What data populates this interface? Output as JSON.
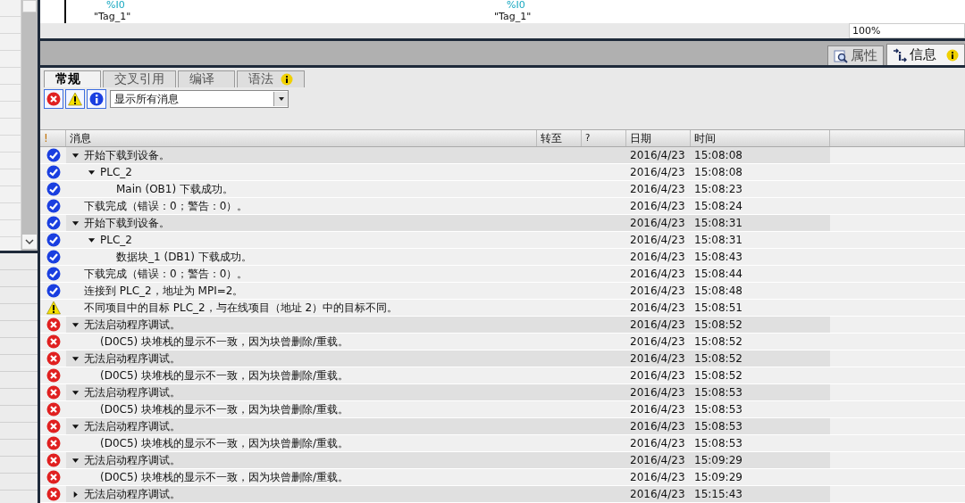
{
  "editor": {
    "operands": [
      {
        "address": "%I0",
        "tag": "\"Tag_1\""
      },
      {
        "address": "%I0",
        "tag": "\"Tag_1\""
      }
    ],
    "zoom": "100%"
  },
  "inspector_tabs": [
    {
      "label": "属性",
      "kind": "properties",
      "selected": false,
      "info": false
    },
    {
      "label": "信息",
      "kind": "info",
      "selected": true,
      "info": true
    }
  ],
  "tabs": [
    {
      "label": "常规",
      "selected": true,
      "info": false
    },
    {
      "label": "交叉引用",
      "selected": false,
      "info": false
    },
    {
      "label": "编译",
      "selected": false,
      "info": false
    },
    {
      "label": "语法",
      "selected": false,
      "info": true
    }
  ],
  "filters": [
    {
      "kind": "error",
      "on": true
    },
    {
      "kind": "warning",
      "on": true
    },
    {
      "kind": "info",
      "on": true
    }
  ],
  "filter_select": {
    "value": "显示所有消息"
  },
  "columns": [
    "!",
    "消息",
    "转至",
    "?",
    "日期",
    "时间"
  ],
  "messages": [
    {
      "kind": "success",
      "text": "开始下载到设备。",
      "date": "2016/4/23",
      "time": "15:08:08",
      "expanded": true,
      "children": [
        {
          "kind": "success",
          "text": "PLC_2",
          "date": "2016/4/23",
          "time": "15:08:08",
          "expanded": true,
          "children": [
            {
              "kind": "success",
              "text": "Main (OB1) 下载成功。",
              "date": "2016/4/23",
              "time": "15:08:23"
            }
          ]
        }
      ]
    },
    {
      "kind": "success",
      "text": "下载完成（错误：0；警告：0）。",
      "date": "2016/4/23",
      "time": "15:08:24"
    },
    {
      "kind": "success",
      "text": "开始下载到设备。",
      "date": "2016/4/23",
      "time": "15:08:31",
      "expanded": true,
      "children": [
        {
          "kind": "success",
          "text": "PLC_2",
          "date": "2016/4/23",
          "time": "15:08:31",
          "expanded": true,
          "children": [
            {
              "kind": "success",
              "text": "数据块_1 (DB1) 下载成功。",
              "date": "2016/4/23",
              "time": "15:08:43"
            }
          ]
        }
      ]
    },
    {
      "kind": "success",
      "text": "下载完成（错误：0；警告：0）。",
      "date": "2016/4/23",
      "time": "15:08:44"
    },
    {
      "kind": "success",
      "text": "连接到 PLC_2，地址为 MPI=2。",
      "date": "2016/4/23",
      "time": "15:08:48"
    },
    {
      "kind": "warning",
      "text": "不同项目中的目标 PLC_2，与在线项目（地址 2）中的目标不同。",
      "date": "2016/4/23",
      "time": "15:08:51"
    },
    {
      "kind": "error",
      "text": "无法启动程序调试。",
      "date": "2016/4/23",
      "time": "15:08:52",
      "expanded": true,
      "children": [
        {
          "kind": "error",
          "text": "(D0C5) 块堆栈的显示不一致，因为块曾删除/重载。",
          "date": "2016/4/23",
          "time": "15:08:52"
        }
      ]
    },
    {
      "kind": "error",
      "text": "无法启动程序调试。",
      "date": "2016/4/23",
      "time": "15:08:52",
      "expanded": true,
      "children": [
        {
          "kind": "error",
          "text": "(D0C5) 块堆栈的显示不一致，因为块曾删除/重载。",
          "date": "2016/4/23",
          "time": "15:08:52"
        }
      ]
    },
    {
      "kind": "error",
      "text": "无法启动程序调试。",
      "date": "2016/4/23",
      "time": "15:08:53",
      "expanded": true,
      "children": [
        {
          "kind": "error",
          "text": "(D0C5) 块堆栈的显示不一致，因为块曾删除/重载。",
          "date": "2016/4/23",
          "time": "15:08:53"
        }
      ]
    },
    {
      "kind": "error",
      "text": "无法启动程序调试。",
      "date": "2016/4/23",
      "time": "15:08:53",
      "expanded": true,
      "children": [
        {
          "kind": "error",
          "text": "(D0C5) 块堆栈的显示不一致，因为块曾删除/重载。",
          "date": "2016/4/23",
          "time": "15:08:53"
        }
      ]
    },
    {
      "kind": "error",
      "text": "无法启动程序调试。",
      "date": "2016/4/23",
      "time": "15:09:29",
      "expanded": true,
      "children": [
        {
          "kind": "error",
          "text": "(D0C5) 块堆栈的显示不一致，因为块曾删除/重载。",
          "date": "2016/4/23",
          "time": "15:09:29"
        }
      ]
    },
    {
      "kind": "error",
      "text": "无法启动程序调试。",
      "date": "2016/4/23",
      "time": "15:15:43",
      "expanded": false
    }
  ]
}
